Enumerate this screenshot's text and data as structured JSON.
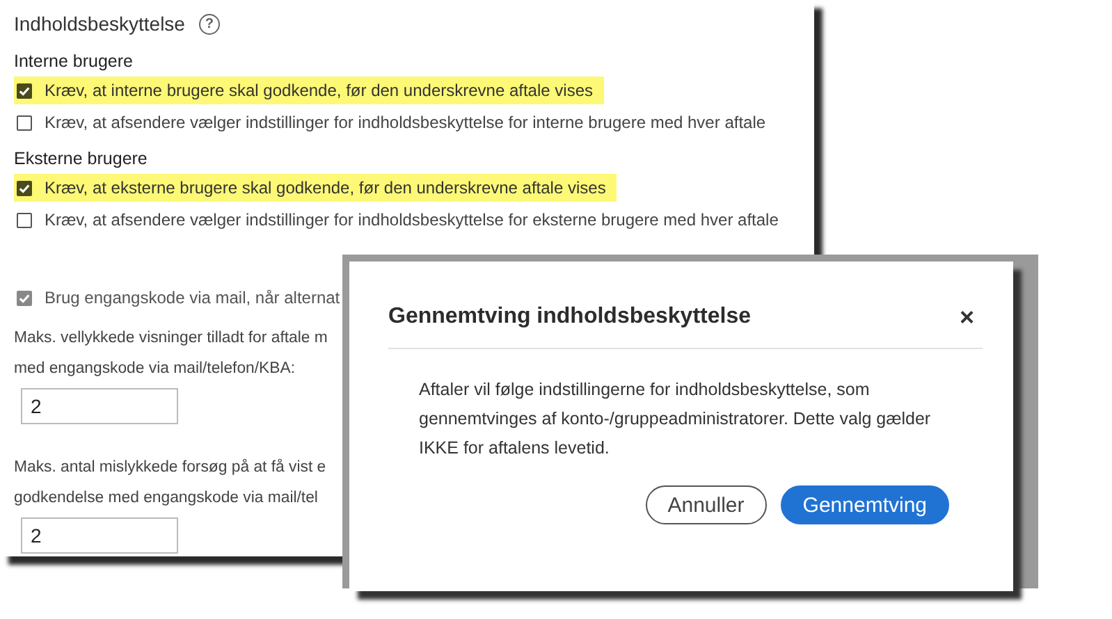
{
  "panel": {
    "title": "Indholdsbeskyttelse",
    "help_icon": "?",
    "sections": [
      {
        "heading": "Interne brugere",
        "options": [
          {
            "label": "Kræv, at interne brugere skal godkende, før den underskrevne aftale vises",
            "checked": true,
            "highlighted": true
          },
          {
            "label": "Kræv, at afsendere vælger indstillinger for indholdsbeskyttelse for interne brugere med hver aftale",
            "checked": false,
            "highlighted": false
          }
        ]
      },
      {
        "heading": "Eksterne brugere",
        "options": [
          {
            "label": "Kræv, at eksterne brugere skal godkende, før den underskrevne aftale vises",
            "checked": true,
            "highlighted": true
          },
          {
            "label": "Kræv, at afsendere vælger indstillinger for indholdsbeskyttelse for eksterne brugere med hver aftale",
            "checked": false,
            "highlighted": false
          }
        ]
      }
    ],
    "otp_option": {
      "label": "Brug engangskode via mail, når alternat",
      "checked": true,
      "disabled": true
    },
    "fields": [
      {
        "label_lines": [
          "Maks. vellykkede visninger tilladt for aftale m",
          "med engangskode via mail/telefon/KBA:"
        ],
        "value": "2"
      },
      {
        "label_lines": [
          "Maks. antal mislykkede forsøg på at få vist e",
          "godkendelse med engangskode via mail/tel"
        ],
        "value": "2"
      }
    ]
  },
  "dialog": {
    "title": "Gennemtving indholdsbeskyttelse",
    "close": "×",
    "body": "Aftaler vil følge indstillingerne for indholdsbeskyttelse, som gennemtvinges af konto-/gruppeadministratorer. Dette valg gælder IKKE for aftalens levetid.",
    "buttons": [
      {
        "label": "Annuller",
        "kind": "secondary"
      },
      {
        "label": "Gennemtving",
        "kind": "primary"
      }
    ]
  }
}
